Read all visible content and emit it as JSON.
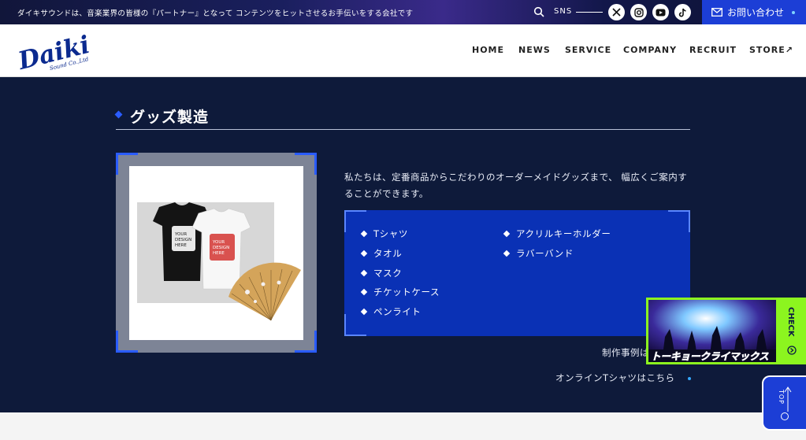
{
  "topbar": {
    "tagline": "ダイキサウンドは、音楽業界の皆様の『パートナー』となって コンテンツをヒットさせるお手伝いをする会社です",
    "sns_label": "SNS",
    "sns_icons": [
      "x-icon",
      "instagram-icon",
      "youtube-icon",
      "tiktok-icon"
    ],
    "contact_label": "お問い合わせ"
  },
  "header": {
    "logo_text": "Daiki",
    "logo_sub": "Sound Co.,Ltd",
    "nav": [
      "HOME",
      "NEWS",
      "SERVICE",
      "COMPANY",
      "RECRUIT",
      "STORE↗"
    ]
  },
  "section": {
    "title": "グッズ製造",
    "photo_tee_text": "YOUR DESIGN HERE",
    "description": "私たちは、定番商品からこだわりのオーダーメイドグッズまで、 幅広くご案内することができます。",
    "items_left": [
      "Tシャツ",
      "タオル",
      "マスク",
      "チケットケース",
      "ペンライト"
    ],
    "items_right": [
      "アクリルキーホルダー",
      "ラバーバンド"
    ],
    "link_examples": "制作事例は",
    "link_online": "オンラインTシャツはこちら"
  },
  "banner": {
    "caption": "トーキョークライマックス",
    "check_label": "CHECK"
  },
  "top_button": {
    "label": "TOP"
  },
  "colors": {
    "accent": "#1c3ed6",
    "navy": "#0e1a3a",
    "list_bg": "#0a31b5",
    "banner_green": "#8cf51f"
  }
}
